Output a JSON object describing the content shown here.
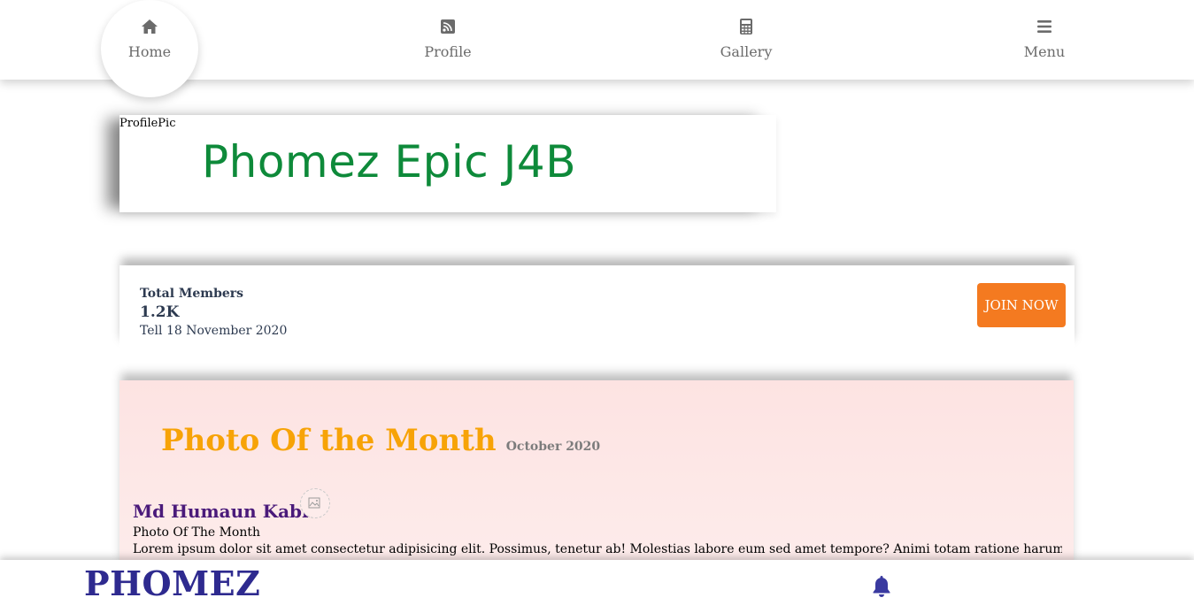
{
  "nav": {
    "home": {
      "label": "Home",
      "icon": "home-icon"
    },
    "profile": {
      "label": "Profile",
      "icon": "rss-icon"
    },
    "gallery": {
      "label": "Gallery",
      "icon": "calculator-icon"
    },
    "menu": {
      "label": "Menu",
      "icon": "menu-icon"
    }
  },
  "banner": {
    "alt_text": "ProfilePic",
    "title": "Phomez Epic J4B"
  },
  "stats": {
    "label": "Total Members",
    "value": "1.2K",
    "date": "Tell 18 November 2020",
    "join_label": "JOIN NOW"
  },
  "photo_of_month": {
    "title": "Photo Of the Month",
    "month": "October 2020",
    "winner_name": "Md Humaun Kabir",
    "caption": "Photo Of The Month",
    "text": "Lorem ipsum dolor sit amet consectetur adipisicing elit. Possimus, tenetur ab! Molestias labore eum sed amet tempore? Animi totam ratione harum"
  },
  "footer": {
    "brand": "PHOMEZ",
    "bell_icon": "bell-icon"
  },
  "colors": {
    "accent_orange": "#f47a20",
    "title_orange": "#f7a307",
    "brand_navy": "#2e2a8f",
    "winner_purple": "#4a1a7a",
    "banner_green": "#0e8a3a",
    "nav_gray": "#6b6b6b"
  }
}
